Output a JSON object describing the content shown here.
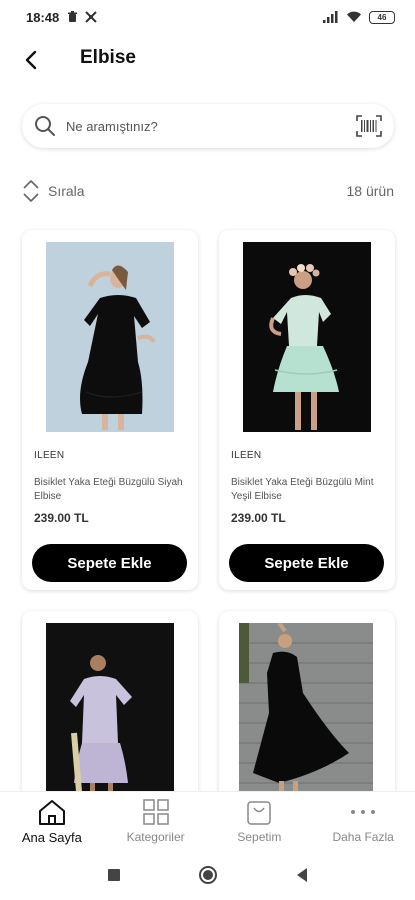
{
  "status_bar": {
    "time": "18:48",
    "battery": "46"
  },
  "header": {
    "title": "Elbise",
    "back_icon": "back-arrow-icon"
  },
  "search": {
    "placeholder": "Ne aramıştınız?",
    "search_icon": "search-icon",
    "barcode_icon": "barcode-scan-icon"
  },
  "sort": {
    "label": "Sırala",
    "count": "18 ürün"
  },
  "products": [
    {
      "brand": "ILEEN",
      "name": "Bisiklet Yaka Eteği Büzgülü Siyah Elbise",
      "price": "239.00 TL",
      "button": "Sepete Ekle",
      "colors": {
        "bg": "#b9ccd8",
        "dress": "#0d0d0d"
      }
    },
    {
      "brand": "ILEEN",
      "name": "Bisiklet Yaka Eteği Büzgülü Mint Yeşil Elbise",
      "price": "239.00 TL",
      "button": "Sepete Ekle",
      "colors": {
        "bg": "#0b0b0b",
        "dress": "#b6e0cf"
      }
    },
    {
      "colors": {
        "bg": "#101010",
        "dress": "#c9c2dc"
      }
    },
    {
      "colors": {
        "bg": "#7d7f80",
        "dress": "#0a0a0a"
      }
    }
  ],
  "nav": {
    "items": [
      {
        "label": "Ana Sayfa",
        "icon": "home-icon",
        "active": true
      },
      {
        "label": "Kategoriler",
        "icon": "grid-icon",
        "active": false
      },
      {
        "label": "Sepetim",
        "icon": "shopping-bag-icon",
        "active": false
      },
      {
        "label": "Daha Fazla",
        "icon": "more-dots-icon",
        "active": false
      }
    ]
  },
  "colors": {
    "accent": "#000000",
    "text_muted": "#666666"
  }
}
